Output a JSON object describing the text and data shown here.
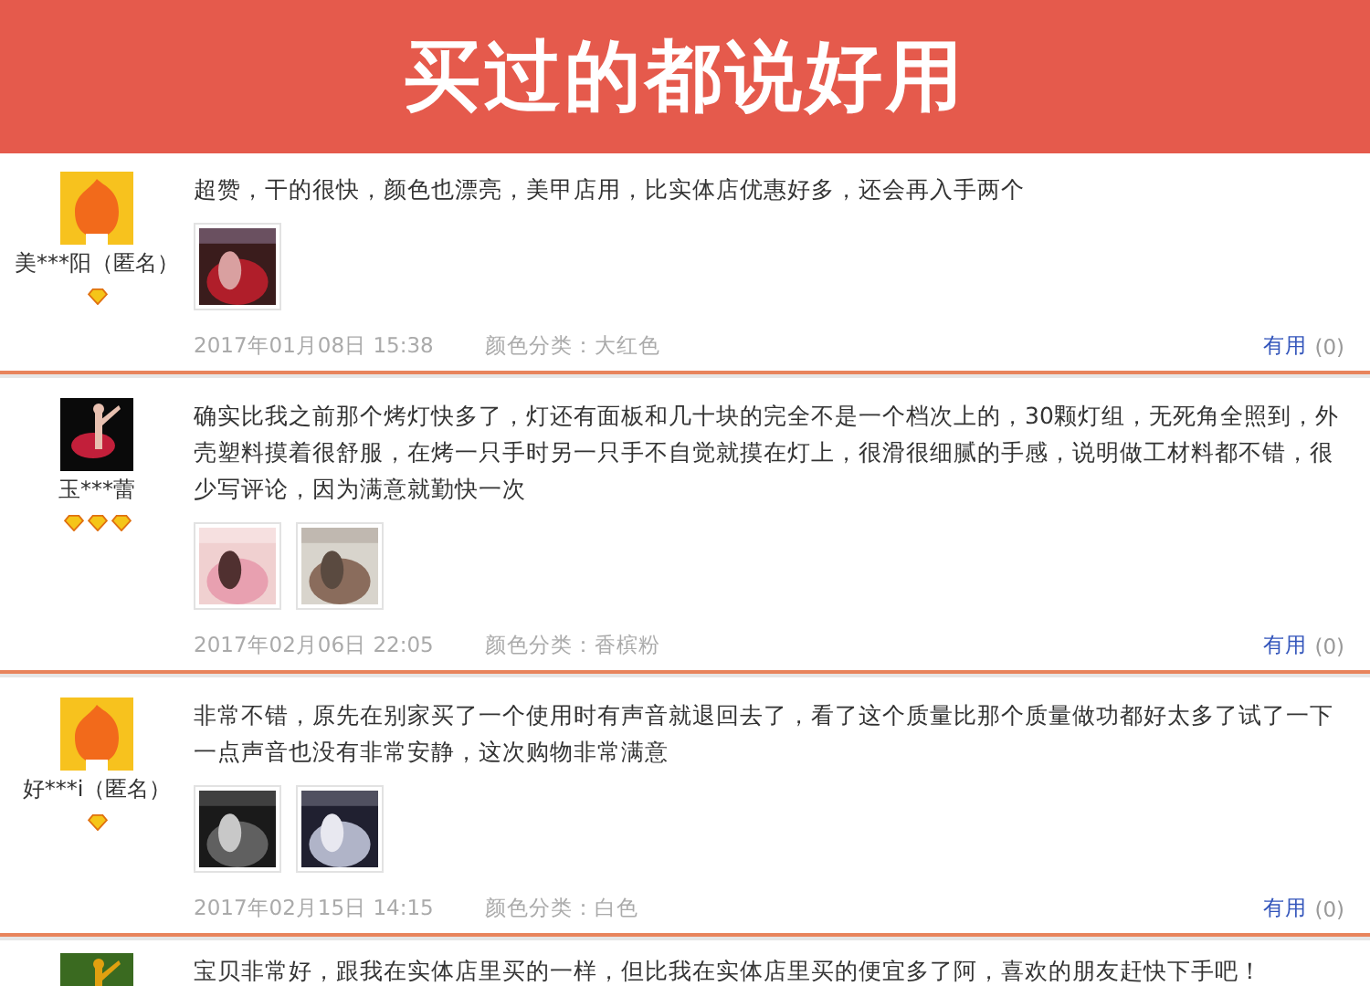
{
  "banner": {
    "title": "买过的都说好用"
  },
  "reviews": [
    {
      "user": "美***阳（匿名）",
      "avatar": {
        "kind": "mascot"
      },
      "badges": [
        {
          "kind": "diamond"
        }
      ],
      "text": "超赞，干的很快，颜色也漂亮，美甲店用，比实体店优惠好多，还会再入手两个",
      "photos": [
        {
          "kind": "picture"
        }
      ],
      "date": "2017年01月08日 15:38",
      "variant": "颜色分类：大红色",
      "helpful_label": "有用",
      "helpful_count": "(0)"
    },
    {
      "user": "玉***蕾",
      "avatar": {
        "kind": "picture"
      },
      "badges": [
        {
          "kind": "diamond"
        },
        {
          "kind": "diamond"
        },
        {
          "kind": "diamond"
        }
      ],
      "text": "确实比我之前那个烤灯快多了，灯还有面板和几十块的完全不是一个档次上的，30颗灯组，无死角全照到，外壳塑料摸着很舒服，在烤一只手时另一只手不自觉就摸在灯上，很滑很细腻的手感，说明做工材料都不错，很少写评论，因为满意就勤快一次",
      "photos": [
        {
          "kind": "picture"
        },
        {
          "kind": "picture"
        }
      ],
      "date": "2017年02月06日 22:05",
      "variant": "颜色分类：香槟粉",
      "helpful_label": "有用",
      "helpful_count": "(0)"
    },
    {
      "user": "好***i（匿名）",
      "avatar": {
        "kind": "mascot"
      },
      "badges": [
        {
          "kind": "diamond"
        }
      ],
      "text": "非常不错，原先在别家买了一个使用时有声音就退回去了，看了这个质量比那个质量做功都好太多了试了一下一点声音也没有非常安静，这次购物非常满意",
      "photos": [
        {
          "kind": "picture"
        },
        {
          "kind": "picture"
        }
      ],
      "date": "2017年02月15日 14:15",
      "variant": "颜色分类：白色",
      "helpful_label": "有用",
      "helpful_count": "(0)"
    },
    {
      "avatar": {
        "kind": "picture"
      },
      "text": "宝贝非常好，跟我在实体店里买的一样，但比我在实体店里买的便宜多了阿，喜欢的朋友赶快下手吧！"
    }
  ]
}
